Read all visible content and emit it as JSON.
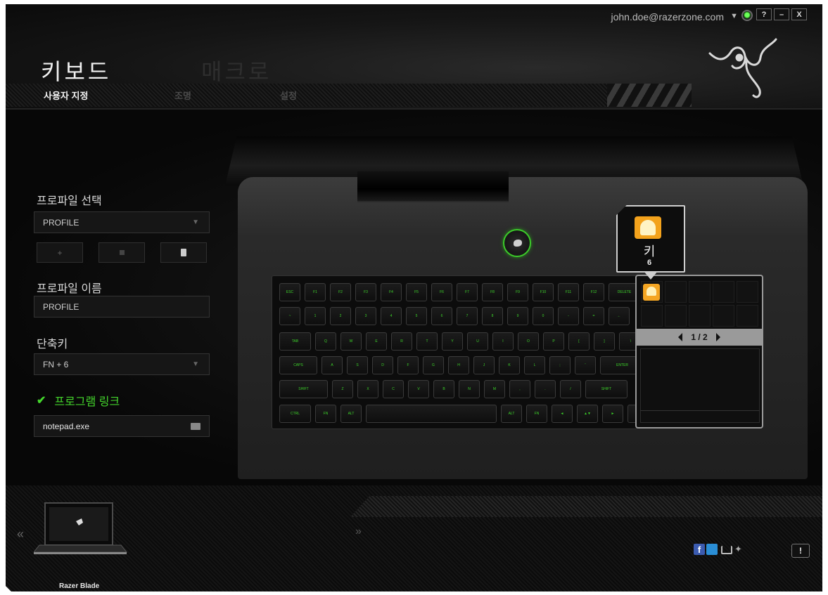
{
  "topbar": {
    "user_email": "john.doe@razerzone.com",
    "caret": "▼",
    "help": "?",
    "minimize": "–",
    "close": "X"
  },
  "tabs": {
    "keyboard": "키보드",
    "macro": "매크로"
  },
  "subtabs": {
    "customize": "사용자 지정",
    "lighting": "조명",
    "settings": "설정"
  },
  "sidebar": {
    "profile_select_label": "프로파일 선택",
    "profile_select_value": "PROFILE",
    "add_symbol": "+",
    "profile_name_label": "프로파일 이름",
    "profile_name_value": "PROFILE",
    "hotkey_label": "단축키",
    "hotkey_value": "FN + 6",
    "program_link_label": "프로그램 링크",
    "program_link_checked": true,
    "program_link_value": "notepad.exe"
  },
  "tooltip": {
    "title": "키",
    "number": "6",
    "icon": "switchblade-key-icon"
  },
  "switchblade": {
    "page": "1 / 2"
  },
  "footer": {
    "nav_prev": "«",
    "nav_next": "»",
    "device_name": "Razer Blade",
    "facebook": "f",
    "alert": "!"
  },
  "keyboard_rows": [
    [
      "ESC",
      "F1",
      "F2",
      "F3",
      "F4",
      "F5",
      "F6",
      "F7",
      "F8",
      "F9",
      "F10",
      "F11",
      "F12",
      "DELETE"
    ],
    [
      "~",
      "1",
      "2",
      "3",
      "4",
      "5",
      "6",
      "7",
      "8",
      "9",
      "0",
      "-",
      "=",
      "←"
    ],
    [
      "TAB",
      "Q",
      "W",
      "E",
      "R",
      "T",
      "Y",
      "U",
      "I",
      "O",
      "P",
      "[",
      "]",
      "\\"
    ],
    [
      "CAPS",
      "A",
      "S",
      "D",
      "F",
      "G",
      "H",
      "J",
      "K",
      "L",
      ";",
      "'",
      "ENTER"
    ],
    [
      "SHIFT",
      "Z",
      "X",
      "C",
      "V",
      "B",
      "N",
      "M",
      ",",
      ".",
      "/",
      "SHIFT"
    ],
    [
      "CTRL",
      "FN",
      "ALT",
      "",
      "ALT",
      "FN",
      "◄",
      "▲▼",
      "►",
      "•"
    ]
  ],
  "colors": {
    "accent": "#44d62c",
    "background": "#0f0f0f",
    "panel_border": "#9a9a9a",
    "key_icon": "#f5a623"
  }
}
